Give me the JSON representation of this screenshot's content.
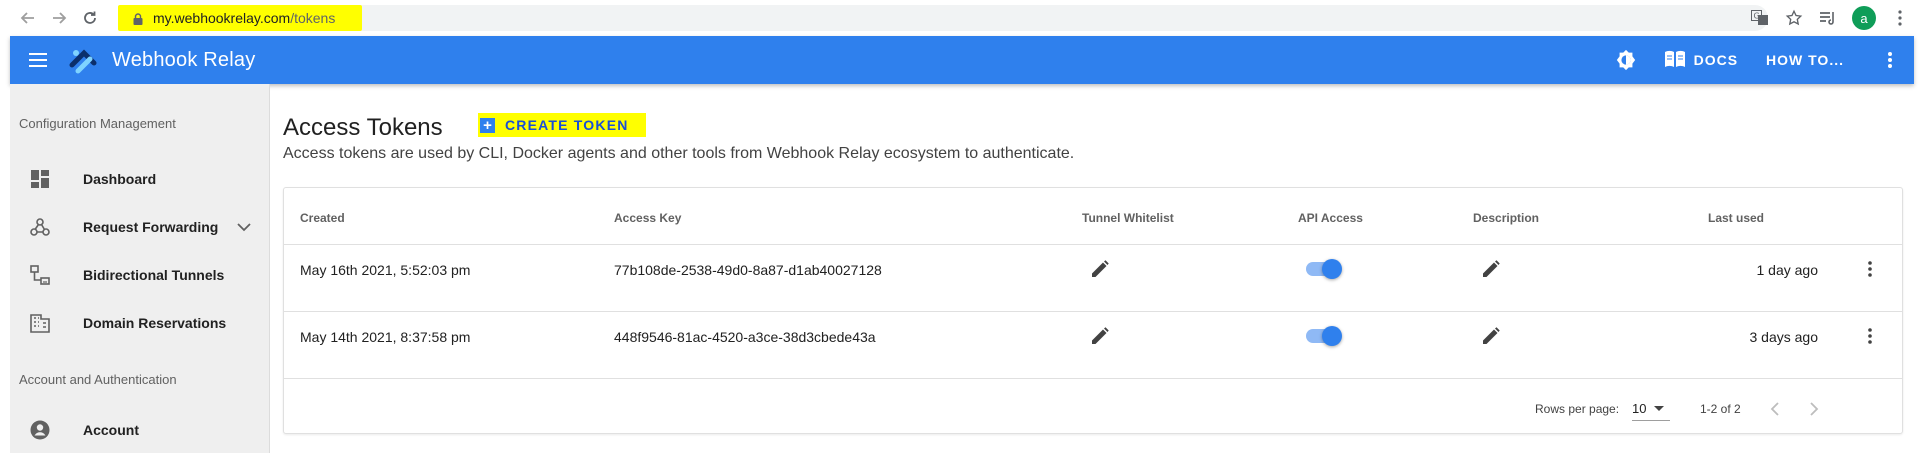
{
  "browser": {
    "url_host": "my.webhookrelay.com",
    "url_path": "/tokens",
    "profile_initial": "a"
  },
  "appbar": {
    "title": "Webhook Relay",
    "docs_label": "DOCS",
    "howto_label": "HOW TO..."
  },
  "sidebar": {
    "section_config": "Configuration Management",
    "section_account": "Account and Authentication",
    "items": [
      {
        "label": "Dashboard"
      },
      {
        "label": "Request Forwarding"
      },
      {
        "label": "Bidirectional Tunnels"
      },
      {
        "label": "Domain Reservations"
      },
      {
        "label": "Account"
      }
    ]
  },
  "main": {
    "title": "Access Tokens",
    "create_label": "CREATE TOKEN",
    "description": "Access tokens are used by CLI, Docker agents and other tools from Webhook Relay ecosystem to authenticate."
  },
  "table": {
    "headers": {
      "created": "Created",
      "access_key": "Access Key",
      "tunnel_whitelist": "Tunnel Whitelist",
      "api_access": "API Access",
      "description": "Description",
      "last_used": "Last used"
    },
    "rows": [
      {
        "created": "May 16th 2021, 5:52:03 pm",
        "access_key": "77b108de-2538-49d0-8a87-d1ab40027128",
        "api_access": true,
        "last_used": "1 day ago"
      },
      {
        "created": "May 14th 2021, 8:37:58 pm",
        "access_key": "448f9546-81ac-4520-a3ce-38d3cbede43a",
        "api_access": true,
        "last_used": "3 days ago"
      }
    ],
    "footer": {
      "rows_per_page_label": "Rows per page:",
      "rows_per_page_value": "10",
      "range": "1-2 of 2"
    }
  },
  "colors": {
    "primary": "#2f80ed",
    "highlight": "#ffff00",
    "sidebar_bg": "#efefef"
  },
  "icons": [
    "back-arrow-icon",
    "forward-arrow-icon",
    "reload-icon",
    "lock-icon",
    "translate-icon",
    "star-icon",
    "reading-list-icon",
    "menu-icon",
    "webhook-relay-logo",
    "theme-toggle-icon",
    "docs-book-icon",
    "more-vert-icon",
    "dashboard-icon",
    "webhook-icon",
    "tunnel-icon",
    "domain-icon",
    "account-circle-icon",
    "chevron-down-icon",
    "pencil-icon",
    "chevron-left-icon",
    "chevron-right-icon",
    "plus-icon"
  ]
}
